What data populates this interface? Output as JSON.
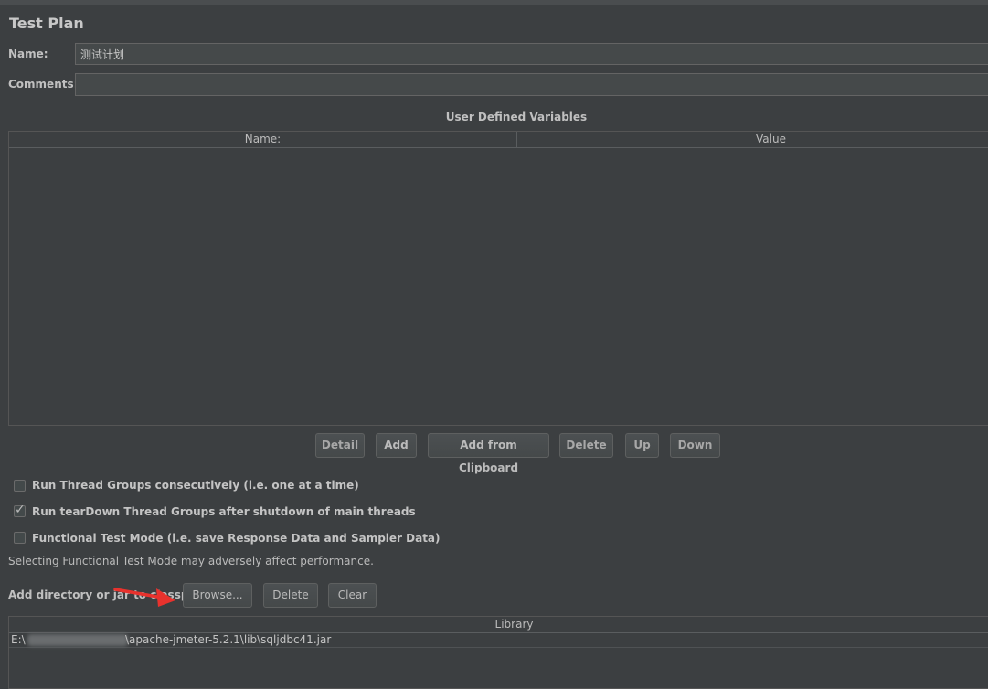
{
  "title": "Test Plan",
  "name_field": {
    "label": "Name:",
    "value": "测试计划"
  },
  "comments_field": {
    "label": "Comments:",
    "value": ""
  },
  "udv": {
    "title": "User Defined Variables",
    "columns": [
      "Name:",
      "Value"
    ],
    "buttons": [
      "Detail",
      "Add",
      "Add from Clipboard",
      "Delete",
      "Up",
      "Down"
    ]
  },
  "options": [
    {
      "label": "Run Thread Groups consecutively (i.e. one at a time)",
      "checked": false
    },
    {
      "label": "Run tearDown Thread Groups after shutdown of main threads",
      "checked": true
    },
    {
      "label": "Functional Test Mode (i.e. save Response Data and Sampler Data)",
      "checked": false
    }
  ],
  "functional_note": "Selecting Functional Test Mode may adversely affect performance.",
  "classpath": {
    "label": "Add directory or jar to classpath",
    "buttons": [
      "Browse...",
      "Delete",
      "Clear"
    ],
    "column": "Library",
    "rows": [
      {
        "prefix": "E:\\",
        "suffix": "\\apache-jmeter-5.2.1\\lib\\sqljdbc41.jar"
      }
    ]
  },
  "colors": {
    "background": "#3c3f41",
    "arrow": "#e8322d"
  }
}
